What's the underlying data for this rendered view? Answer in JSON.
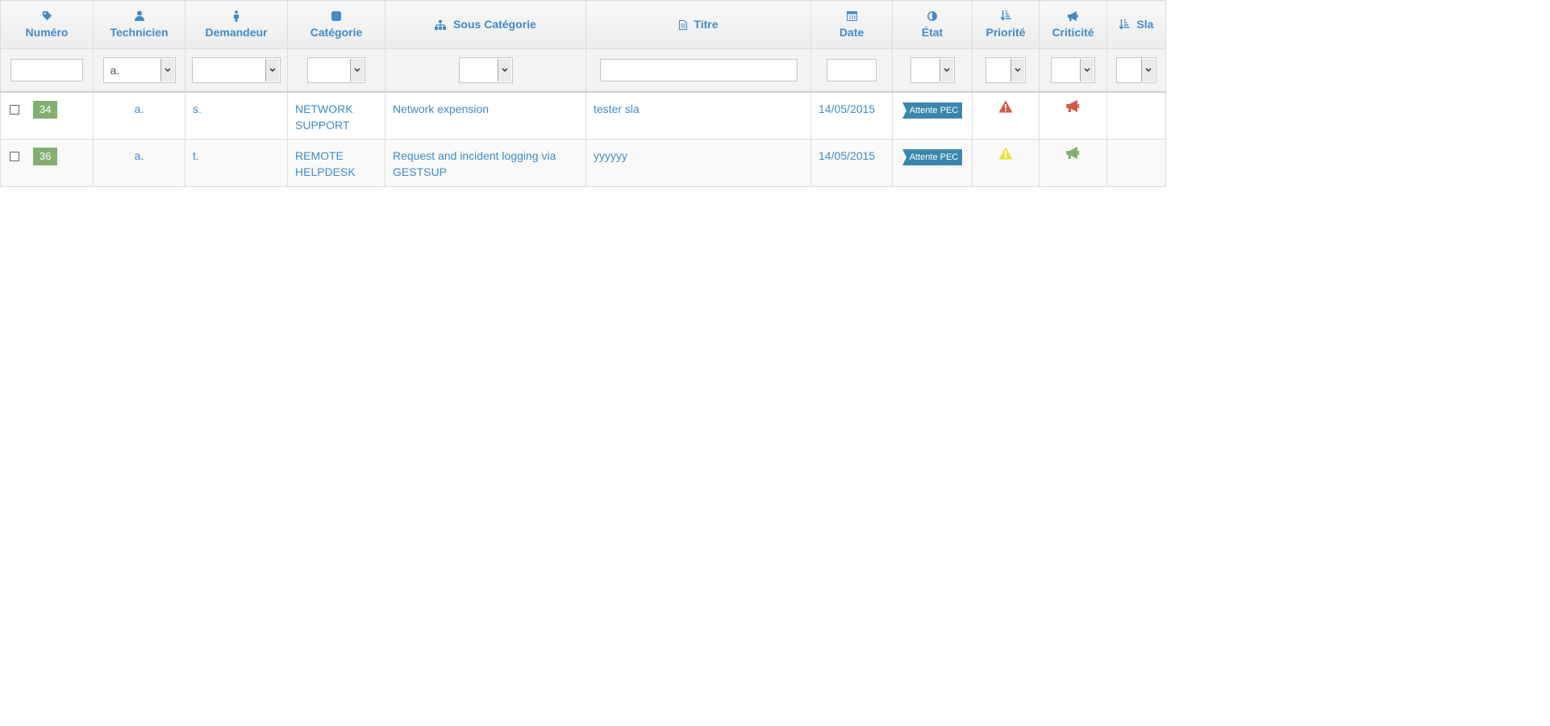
{
  "columns": [
    {
      "key": "numero",
      "label": "Numéro",
      "icon": "tag-icon"
    },
    {
      "key": "technicien",
      "label": "Technicien",
      "icon": "user-icon"
    },
    {
      "key": "demandeur",
      "label": "Demandeur",
      "icon": "person-icon"
    },
    {
      "key": "categorie",
      "label": "Catégorie",
      "icon": "square-icon"
    },
    {
      "key": "sous_categorie",
      "label": "Sous Catégorie",
      "icon": "sitemap-icon"
    },
    {
      "key": "titre",
      "label": "Titre",
      "icon": "document-icon"
    },
    {
      "key": "date",
      "label": "Date",
      "icon": "calendar-icon"
    },
    {
      "key": "etat",
      "label": "État",
      "icon": "adjust-icon"
    },
    {
      "key": "priorite",
      "label": "Priorité",
      "icon": "sort-amount-icon"
    },
    {
      "key": "criticite",
      "label": "Criticité",
      "icon": "bullhorn-icon"
    },
    {
      "key": "sla",
      "label": "Sla",
      "icon": "sort-amount-icon"
    }
  ],
  "filters": {
    "numero": "",
    "technicien": "a.",
    "demandeur": "",
    "categorie": "",
    "sous_categorie": "",
    "titre": "",
    "date": "",
    "etat": "",
    "priorite": "",
    "criticite": "",
    "sla": ""
  },
  "rows": [
    {
      "numero": "34",
      "technicien": "a.",
      "demandeur": "s.",
      "categorie": "NETWORK SUPPORT",
      "sous_categorie": "Network expension",
      "titre": "tester sla",
      "date": "14/05/2015",
      "etat": "Attente PEC",
      "priorite_icon": "warning-icon",
      "priorite_color": "#d15b47",
      "criticite_icon": "bullhorn-icon",
      "criticite_color": "#d15b47",
      "sla": ""
    },
    {
      "numero": "36",
      "technicien": "a.",
      "demandeur": "t.",
      "categorie": "REMOTE HELPDESK",
      "sous_categorie": "Request and incident logging via GESTSUP",
      "titre": "yyyyyy",
      "date": "14/05/2015",
      "etat": "Attente PEC",
      "priorite_icon": "warning-icon",
      "priorite_color": "#e8e33a",
      "criticite_icon": "bullhorn-icon",
      "criticite_color": "#82af6f",
      "sla": ""
    }
  ],
  "colors": {
    "link": "#428bca",
    "number_badge": "#82af6f",
    "state_badge": "#3a87ad",
    "header_bg": "#f2f2f2",
    "border": "#dddddd"
  }
}
